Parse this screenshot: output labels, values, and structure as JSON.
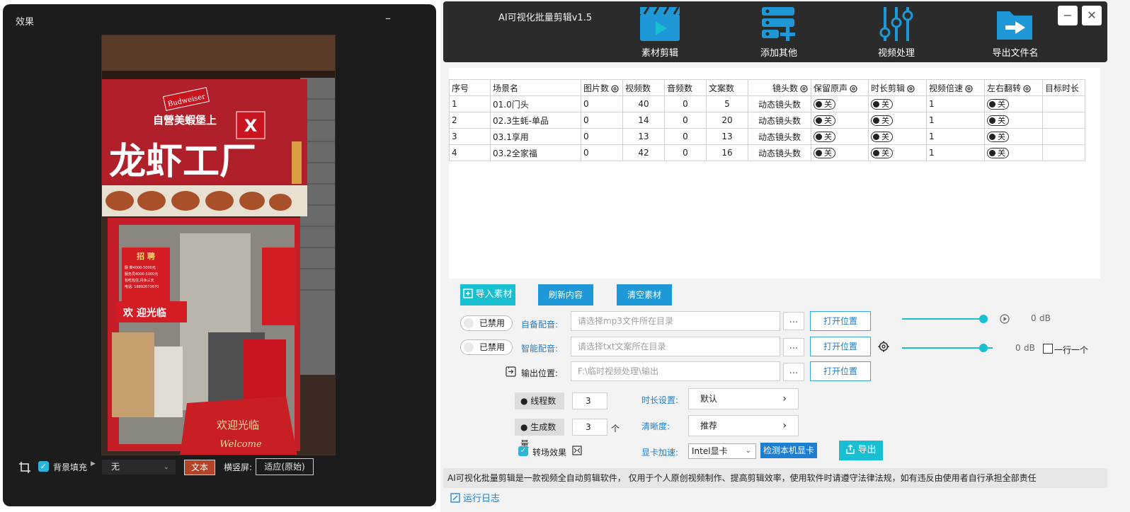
{
  "preview_window": {
    "title": "效果",
    "minimize": "–",
    "bottom": {
      "bg_fill_label": "背景填充",
      "bg_fill_value": "无",
      "text_button": "文本",
      "orientation_label": "横竖屏:",
      "orientation_value": "适应(原始)"
    },
    "image_sign": {
      "top_line": "自營美蝦堡上",
      "shop_name": "龙虾工厂",
      "beer_brand": "Budweiser",
      "hiring_title": "招 聘",
      "hiring_lines": [
        "厨 菜4000-5000元",
        "服务员4000-5000元",
        "包吃包住,月休三天",
        "电话: 18892673670"
      ],
      "welcome_banner": "欢 迎光临",
      "mat_text": "欢迎光临",
      "mat_text2": "Welcome"
    }
  },
  "app": {
    "title": "AI可视化批量剪辑v1.5",
    "tools": [
      {
        "label": "素材剪辑",
        "icon": "clapperboard-icon"
      },
      {
        "label": "添加其他",
        "icon": "add-list-icon"
      },
      {
        "label": "视频处理",
        "icon": "sliders-icon"
      },
      {
        "label": "导出文件名",
        "icon": "export-folder-icon"
      }
    ],
    "window_buttons": {
      "minimize": "−",
      "close": "✕"
    },
    "table": {
      "headers": [
        "序号",
        "场景名",
        "图片数",
        "视频数",
        "音频数",
        "文案数",
        "镜头数",
        "保留原声",
        "时长剪辑",
        "视频倍速",
        "左右翻转",
        "目标时长"
      ],
      "toggle_off": "关",
      "rows": [
        {
          "no": "1",
          "scene": "01.0门头",
          "images": "0",
          "videos": "40",
          "audio": "0",
          "copy": "5",
          "shots": "动态镜头数",
          "speed": "1"
        },
        {
          "no": "2",
          "scene": "02.3生蚝-单品",
          "images": "0",
          "videos": "14",
          "audio": "0",
          "copy": "20",
          "shots": "动态镜头数",
          "speed": "1"
        },
        {
          "no": "3",
          "scene": "03.1享用",
          "images": "0",
          "videos": "13",
          "audio": "0",
          "copy": "13",
          "shots": "动态镜头数",
          "speed": "1"
        },
        {
          "no": "4",
          "scene": "03.2全家福",
          "images": "0",
          "videos": "42",
          "audio": "0",
          "copy": "16",
          "shots": "动态镜头数",
          "speed": "1"
        }
      ]
    },
    "actions": {
      "import": "导入素材",
      "refresh": "刷新内容",
      "clear": "清空素材"
    },
    "settings": {
      "disabled_label": "已禁用",
      "own_audio_label": "自备配音:",
      "own_audio_placeholder": "请选择mp3文件所在目录",
      "smart_audio_label": "智能配音:",
      "smart_audio_placeholder": "请选择txt文案所在目录",
      "output_label": "输出位置:",
      "output_value": "F:\\临时视频处理\\输出",
      "browse": "...",
      "open_location": "打开位置",
      "db_value1": "0",
      "db_value2": "0",
      "db_unit": "dB",
      "one_line_label": "一行一个",
      "threads_label": "线程数",
      "threads_value": "3",
      "gen_count_label": "生成数量",
      "gen_count_value": "3",
      "gen_count_unit": "个",
      "transition_label": "转场效果",
      "duration_label": "时长设置:",
      "duration_value": "默认",
      "clarity_label": "清晰度:",
      "clarity_value": "推荐",
      "gpu_label": "显卡加速:",
      "gpu_value": "Intel显卡",
      "detect_gpu": "检测本机显卡",
      "export": "导出"
    },
    "notice": "AI可视化批量剪辑是一款视频全自动剪辑软件， 仅用于个人原创视频制作、提高剪辑效率，使用软件时请遵守法律法规，如有违反由使用者自行承担全部责任",
    "log_label": "运行日志"
  },
  "colors": {
    "accent": "#17bfd0",
    "blue": "#1e98d6",
    "dark": "#2b2b2b"
  }
}
